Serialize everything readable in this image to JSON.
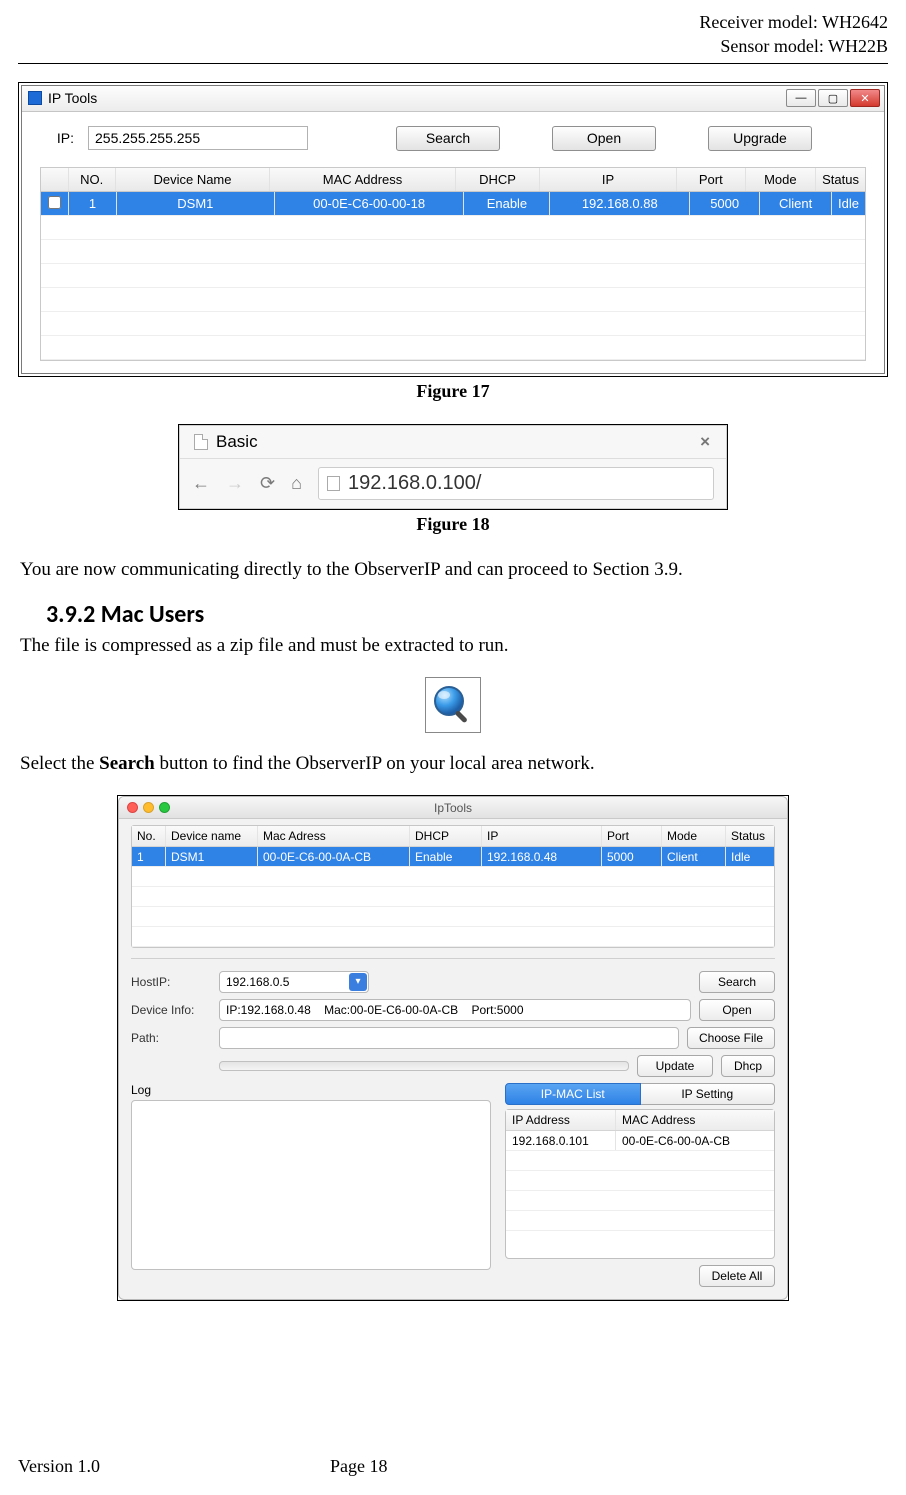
{
  "header": {
    "line1": "Receiver model: WH2642",
    "line2": "Sensor model: WH22B"
  },
  "fig17": {
    "caption": "Figure 17",
    "title": "IP Tools",
    "ip_label": "IP:",
    "ip_value": "255.255.255.255",
    "btn_search": "Search",
    "btn_open": "Open",
    "btn_upgrade": "Upgrade",
    "cols": {
      "no": "NO.",
      "dn": "Device Name",
      "mac": "MAC Address",
      "dhcp": "DHCP",
      "ip": "IP",
      "port": "Port",
      "mode": "Mode",
      "status": "Status"
    },
    "row": {
      "no": "1",
      "dn": "DSM1",
      "mac": "00-0E-C6-00-00-18",
      "dhcp": "Enable",
      "ip": "192.168.0.88",
      "port": "5000",
      "mode": "Client",
      "status": "Idle"
    }
  },
  "fig18": {
    "caption": "Figure 18",
    "tab_label": "Basic",
    "url": "192.168.0.100/"
  },
  "para1": "You are now communicating directly to the ObserverIP and can proceed to Section 3.9.",
  "sec_heading": "3.9.2  Mac Users",
  "para2": "The file is compressed as a zip file and must be extracted to run.",
  "para3_pre": "Select the ",
  "para3_bold": "Search",
  "para3_post": " button to find the ObserverIP on your local area network.",
  "mac": {
    "title": "IpTools",
    "cols": {
      "no": "No.",
      "dn": "Device name",
      "mac": "Mac Adress",
      "dhcp": "DHCP",
      "ip": "IP",
      "port": "Port",
      "mode": "Mode",
      "status": "Status"
    },
    "row": {
      "no": "1",
      "dn": "DSM1",
      "mac": "00-0E-C6-00-0A-CB",
      "dhcp": "Enable",
      "ip": "192.168.0.48",
      "port": "5000",
      "mode": "Client",
      "status": "Idle"
    },
    "hostip_label": "HostIP:",
    "hostip_value": "192.168.0.5",
    "devinfo_label": "Device Info:",
    "devinfo_value": "IP:192.168.0.48    Mac:00-0E-C6-00-0A-CB    Port:5000",
    "path_label": "Path:",
    "btn_search": "Search",
    "btn_open": "Open",
    "btn_choose": "Choose File",
    "btn_update": "Update",
    "btn_dhcp": "Dhcp",
    "log_label": "Log",
    "seg_list": "IP-MAC List",
    "seg_setting": "IP Setting",
    "ipmac_h1": "IP Address",
    "ipmac_h2": "MAC Address",
    "ipmac_r1_ip": "192.168.0.101",
    "ipmac_r1_mac": "00-0E-C6-00-0A-CB",
    "btn_delete": "Delete All"
  },
  "footer": {
    "version": "Version 1.0",
    "page": "Page 18"
  }
}
